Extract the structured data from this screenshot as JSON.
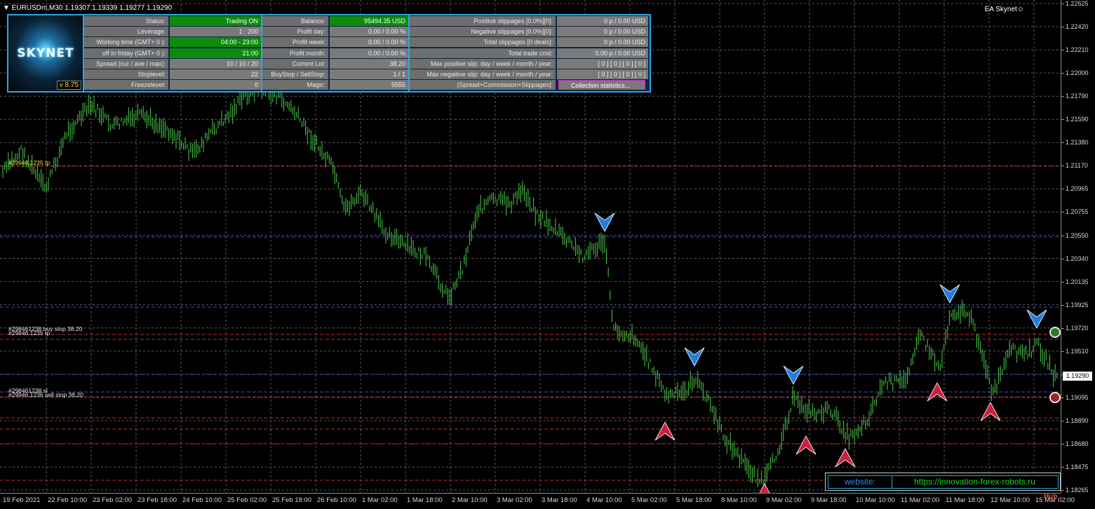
{
  "header": {
    "symbol_line": "▼ EURUSDm,M30  1.19307 1.19339 1.19277 1.19290",
    "ea_name": "EA Skynet☺"
  },
  "logo": {
    "text": "SKYNET",
    "version": "v 8.75"
  },
  "panel": {
    "col1": [
      {
        "label": "Status:",
        "value": "Trading ON",
        "green": true
      },
      {
        "label": "Leverage:",
        "value": "1 : 200",
        "green": false
      },
      {
        "label": "Working time (GMT+ 0 ):",
        "value": "04:00 - 23:00",
        "green": true
      },
      {
        "label": "off in friday (GMT+ 0 ):",
        "value": "21:00",
        "green": true
      },
      {
        "label": "Spread (cur / ave / max):",
        "value": "10 / 10 / 20",
        "green": false
      },
      {
        "label": "Stoplevel:",
        "value": "22",
        "green": false
      },
      {
        "label": "Freezelevel:",
        "value": "0",
        "green": false
      }
    ],
    "col2": [
      {
        "label": "Balance:",
        "value": "95494.35 USD",
        "green": true
      },
      {
        "label": "Profit day:",
        "value": "0.00 / 0.00 %",
        "green": false
      },
      {
        "label": "Profit week:",
        "value": "0.00 / 0.00 %",
        "green": false
      },
      {
        "label": "Profit month:",
        "value": "0.00 / 0.00 %",
        "green": false
      },
      {
        "label": "Current Lot:",
        "value": "38.20",
        "green": false
      },
      {
        "label": "BuyStop / SellStop:",
        "value": "1  /  1",
        "green": false
      },
      {
        "label": "Magic:",
        "value": "5555",
        "green": false
      }
    ],
    "col3": [
      {
        "label": "Positive slippages [0.0%][0]:",
        "value": "0 p / 0.00 USD"
      },
      {
        "label": "Negative slippages [0.0%][0]:",
        "value": "0 p / 0.00 USD"
      },
      {
        "label": "Total slippages [0 deals]:",
        "value": "0 p / 0.00 USD"
      },
      {
        "label": "Total trade cost:",
        "value": "0.00 p / 0.00 USD"
      },
      {
        "label": "Max positive slip: day / week / month / year:",
        "value": "[ 0 ] [ 0 ] [ 0 ] [ 0 ]"
      },
      {
        "label": "Max negaitive slip: day / week / month / year:",
        "value": "[ 0 ] [ 0 ] [ 0 ] [ 0 ]"
      },
      {
        "label": "[Spread+Commission+Slippages]:",
        "value": "Collection statistics..."
      }
    ]
  },
  "price_axis": [
    "1.22625",
    "1.22420",
    "1.22210",
    "1.22000",
    "1.21790",
    "1.21590",
    "1.21380",
    "1.21170",
    "1.20965",
    "1.20755",
    "1.20550",
    "1.20340",
    "1.20135",
    "1.19925",
    "1.19720",
    "1.19510",
    "1.19300",
    "1.19095",
    "1.18890",
    "1.18680",
    "1.18475",
    "1.18265"
  ],
  "current_price": "1.19290",
  "time_axis": [
    "19 Feb 2021",
    "22 Feb 10:00",
    "23 Feb 02:00",
    "23 Feb 18:00",
    "24 Feb 10:00",
    "25 Feb 02:00",
    "25 Feb 18:00",
    "26 Feb 10:00",
    "1 Mar 02:00",
    "1 Mar 18:00",
    "2 Mar 10:00",
    "3 Mar 02:00",
    "3 Mar 18:00",
    "4 Mar 10:00",
    "5 Mar 02:00",
    "5 Mar 18:00",
    "8 Mar 10:00",
    "9 Mar 02:00",
    "9 Mar 18:00",
    "10 Mar 10:00",
    "11 Mar 02:00",
    "11 Mar 18:00",
    "12 Mar 10:00",
    "15 Mar 02:00"
  ],
  "order_labels": {
    "tp": "#29946.1235 tp",
    "buy_stop_a": "#298461238 buy stop 38.20",
    "buy_stop_b": "#29946.1235 tp",
    "sell_stop_a": "#298461238 sl",
    "sell_stop_b": "#29946.1236 sell stop 38.20"
  },
  "website": {
    "label": "website:",
    "url": "https://innovation-forex-robots.ru"
  },
  "watermark": "Hub",
  "colors": {
    "accent": "#2aa5e6",
    "candle": "#3fae3f",
    "buy_arrow": "#1e7fe0",
    "sell_arrow": "#d01e3c",
    "grid": "#5a5a5a"
  }
}
